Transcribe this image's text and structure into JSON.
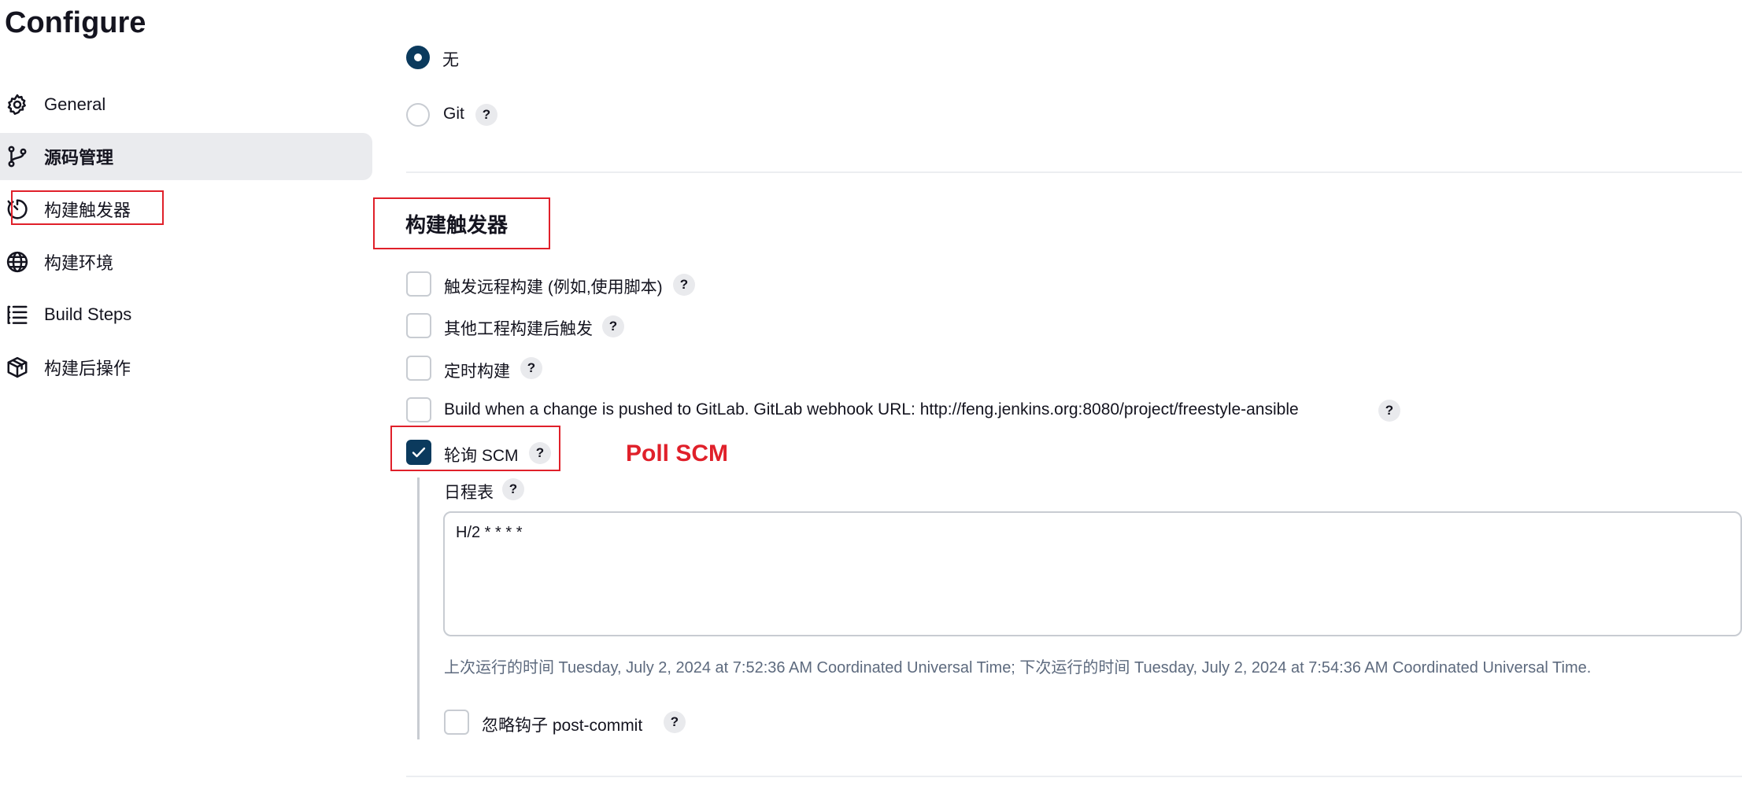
{
  "page": {
    "title": "Configure"
  },
  "sidebar": {
    "items": [
      {
        "label": "General",
        "icon": "gear-icon"
      },
      {
        "label": "源码管理",
        "icon": "git-branch-icon",
        "active": true
      },
      {
        "label": "构建触发器",
        "icon": "clock-trigger-icon"
      },
      {
        "label": "构建环境",
        "icon": "globe-icon"
      },
      {
        "label": "Build Steps",
        "icon": "list-icon"
      },
      {
        "label": "构建后操作",
        "icon": "package-icon"
      }
    ]
  },
  "scm": {
    "options": [
      {
        "label": "无",
        "selected": true
      },
      {
        "label": "Git",
        "selected": false,
        "help": "?"
      }
    ]
  },
  "triggers": {
    "title": "构建触发器",
    "options": [
      {
        "label": "触发远程构建 (例如,使用脚本)",
        "checked": false,
        "help": "?"
      },
      {
        "label": "其他工程构建后触发",
        "checked": false,
        "help": "?"
      },
      {
        "label": "定时构建",
        "checked": false,
        "help": "?"
      },
      {
        "label": "Build when a change is pushed to GitLab. GitLab webhook URL: http://feng.jenkins.org:8080/project/freestyle-ansible",
        "checked": false,
        "help": "?"
      },
      {
        "label": "轮询 SCM",
        "checked": true,
        "help": "?"
      }
    ],
    "poll_scm": {
      "annotation": "Poll SCM",
      "schedule_label": "日程表",
      "schedule_help": "?",
      "schedule_value": "H/2 * * * *",
      "run_info": "上次运行的时间 Tuesday, July 2, 2024 at 7:52:36 AM Coordinated Universal Time; 下次运行的时间 Tuesday, July 2, 2024 at 7:54:36 AM Coordinated Universal Time.",
      "ignore_hooks_label": "忽略钩子 post-commit",
      "ignore_hooks_checked": false,
      "ignore_hooks_help": "?"
    }
  },
  "colors": {
    "accent": "#0b3a5d",
    "annotation_red": "#e0202a",
    "active_nav_bg": "#eaebee"
  }
}
